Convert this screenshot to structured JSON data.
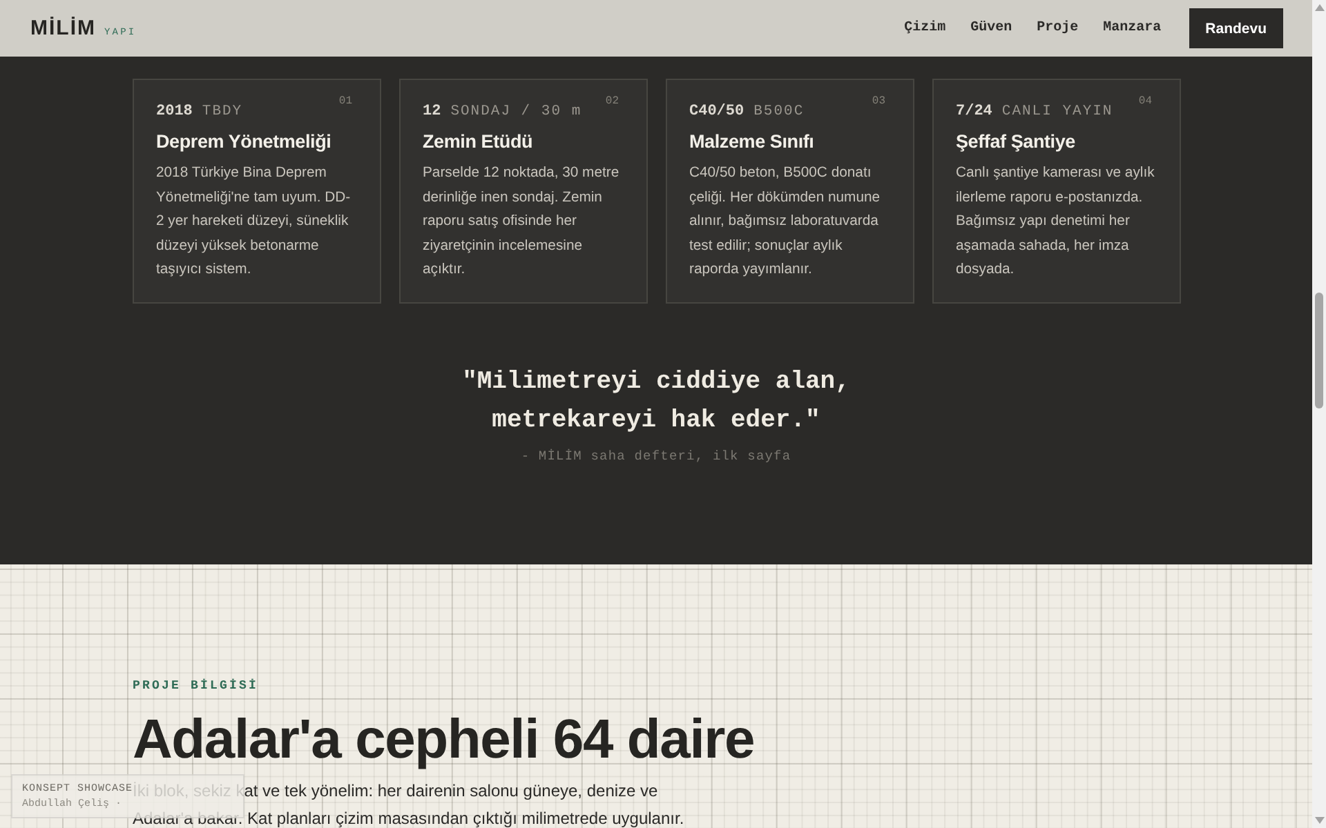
{
  "header": {
    "logo": "MİLİM",
    "logo_tag": "YAPI",
    "nav": [
      "Çizim",
      "Güven",
      "Proje",
      "Manzara"
    ],
    "cta": "Randevu"
  },
  "features": [
    {
      "number": "01",
      "figure": "2018",
      "unit": "TBDY",
      "title": "Deprem Yönetmeliği",
      "text": "2018 Türkiye Bina Deprem Yönetmeliği'ne tam uyum. DD-2 yer hareketi düzeyi, süneklik düzeyi yüksek betonarme taşıyıcı sistem."
    },
    {
      "number": "02",
      "figure": "12",
      "unit": "SONDAJ / 30 m",
      "title": "Zemin Etüdü",
      "text": "Parselde 12 noktada, 30 metre derinliğe inen sondaj. Zemin raporu satış ofisinde her ziyaretçinin incelemesine açıktır."
    },
    {
      "number": "03",
      "figure": "C40/50",
      "unit": "B500C",
      "title": "Malzeme Sınıfı",
      "text": "C40/50 beton, B500C donatı çeliği. Her dökümden numune alınır, bağımsız laboratuvarda test edilir; sonuçlar aylık raporda yayımlanır."
    },
    {
      "number": "04",
      "figure": "7/24",
      "unit": "CANLI YAYIN",
      "title": "Şeffaf Şantiye",
      "text": "Canlı şantiye kamerası ve aylık ilerleme raporu e-postanızda. Bağımsız yapı denetimi her aşamada sahada, her imza dosyada."
    }
  ],
  "quote": {
    "text": "\"Milimetreyi ciddiye alan, metrekareyi hak eder.\"",
    "source": "- MİLİM saha defteri, ilk sayfa"
  },
  "project": {
    "eyebrow": "PROJE BİLGİSİ",
    "heading": "Adalar'a cepheli 64 daire",
    "paragraph": "İki blok, sekiz kat ve tek yönelim: her dairenin salonu güneye, denize ve Adalar'a bakar. Kat planları çizim masasından çıktığı milimetrede uygulanır."
  },
  "credit_badge": {
    "label": "KONSEPT SHOWCASE",
    "author": "Abdullah Çeliş ·"
  }
}
